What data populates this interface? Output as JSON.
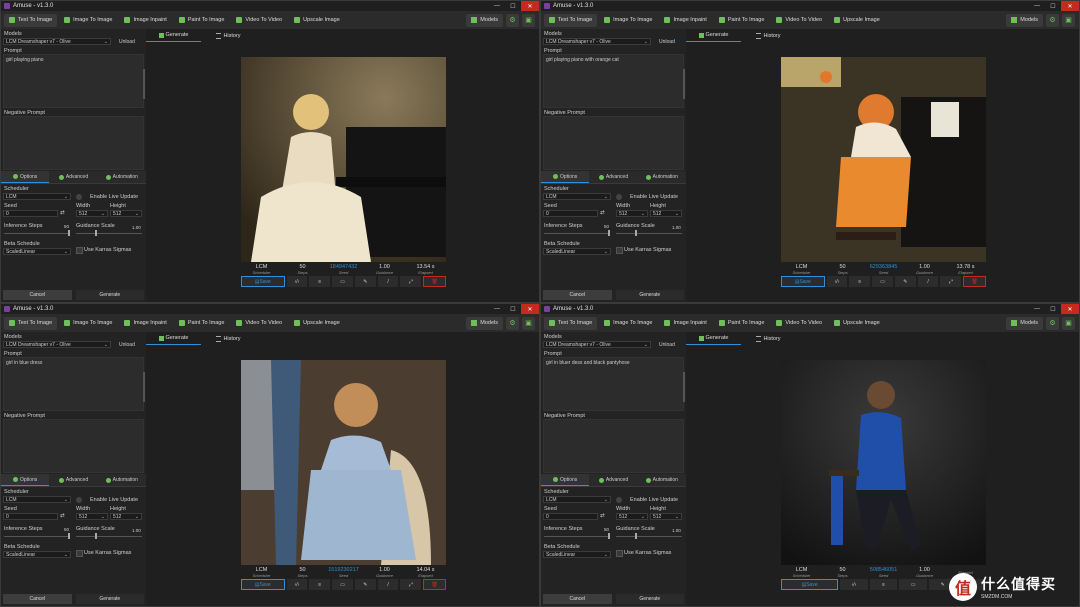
{
  "app": {
    "title": "Amuse - v1.3.0"
  },
  "toolbar": {
    "items": [
      "Text To Image",
      "Image To Image",
      "Image Inpaint",
      "Paint To Image",
      "Video To Video",
      "Upscale Image"
    ],
    "models_label": "Models"
  },
  "left": {
    "models_label": "Models",
    "model_value": "LCM Dreamshaper v7 - Olive",
    "unload_label": "Unload",
    "prompt_label": "Prompt",
    "negative_label": "Negative Prompt",
    "tabs": [
      "Options",
      "Advanced",
      "Automation"
    ],
    "scheduler_label": "Scheduler",
    "scheduler_value": "LCM",
    "live_update_label": "Enable Live Update",
    "seed_label": "Seed",
    "seed_value": "0",
    "width_label": "Width",
    "width_value": "512",
    "height_label": "Height",
    "height_value": "512",
    "steps_label": "Inference Steps",
    "steps_value": "50",
    "guidance_label": "Guidance Scale",
    "guidance_value": "1.00",
    "beta_label": "Beta Schedule",
    "beta_value": "ScaledLinear",
    "karras_label": "Use Karras Sigmas",
    "cancel_label": "Cancel",
    "generate_label": "Generate"
  },
  "main": {
    "tabs": [
      "Generate",
      "History"
    ],
    "stat_keys": [
      "Scheduler",
      "Steps",
      "Seed",
      "Guidance",
      "Elapsed"
    ],
    "save_label": "Save"
  },
  "panels": [
    {
      "prompt": "girl playing piano",
      "seed": "184947432",
      "elapsed": "13.54 s",
      "scheduler": "LCM",
      "steps": "50",
      "guidance": "1.00"
    },
    {
      "prompt": "girl playing piano with orange cat",
      "seed": "629363845",
      "elapsed": "13.78 s",
      "scheduler": "LCM",
      "steps": "50",
      "guidance": "1.00"
    },
    {
      "prompt": "girl in blue dress",
      "seed": "1519230217",
      "elapsed": "14.04 s",
      "scheduler": "LCM",
      "steps": "50",
      "guidance": "1.00"
    },
    {
      "prompt": "girl in bluer dess and black pantyhose",
      "seed": "508546051",
      "elapsed": "",
      "scheduler": "LCM",
      "steps": "50",
      "guidance": "1.00"
    }
  ],
  "watermark": {
    "logo": "值",
    "text": "什么值得买",
    "sub": "SMZDM.COM"
  },
  "colors": {
    "accent": "#2f8fd8",
    "icon_green": "#6fbf5a",
    "close_red": "#c42b1c"
  }
}
